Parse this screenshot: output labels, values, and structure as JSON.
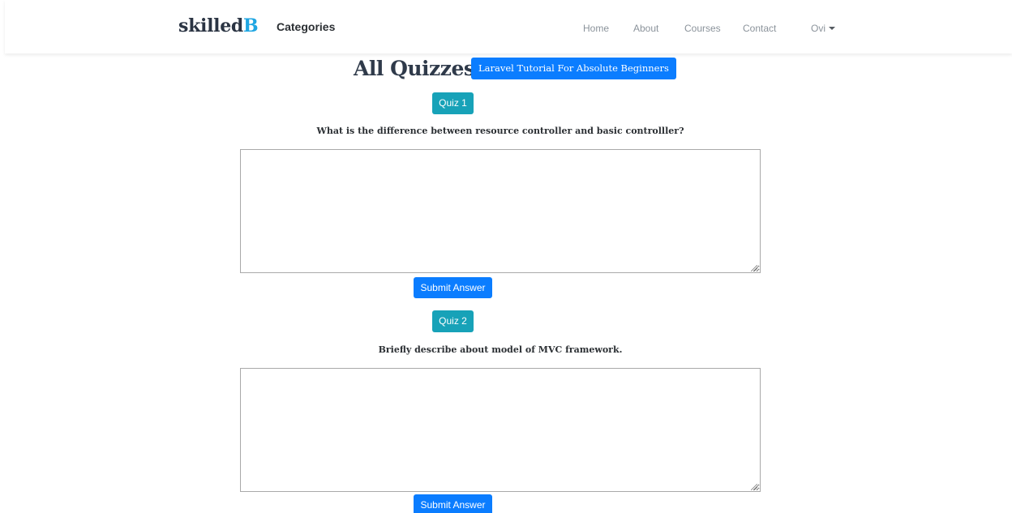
{
  "navbar": {
    "brand_main": "skilled",
    "brand_accent": "B",
    "categories_label": "Categories",
    "links": [
      "Home",
      "About",
      "Courses",
      "Contact"
    ],
    "user_menu_label": "Ovi"
  },
  "page": {
    "title": "All Quizzes",
    "course_label": "Laravel Tutorial For Absolute Beginners"
  },
  "quizzes": [
    {
      "label": "Quiz 1",
      "question": "What is the difference between resource controller and basic controlller?",
      "answer_value": "",
      "submit_label": "Submit Answer"
    },
    {
      "label": "Quiz 2",
      "question": "Briefly describe about model of MVC framework.",
      "answer_value": "",
      "submit_label": "Submit Answer"
    }
  ],
  "colors": {
    "brand_accent": "#1fa6e2",
    "primary": "#0b7dff",
    "info": "#17a2b8"
  }
}
